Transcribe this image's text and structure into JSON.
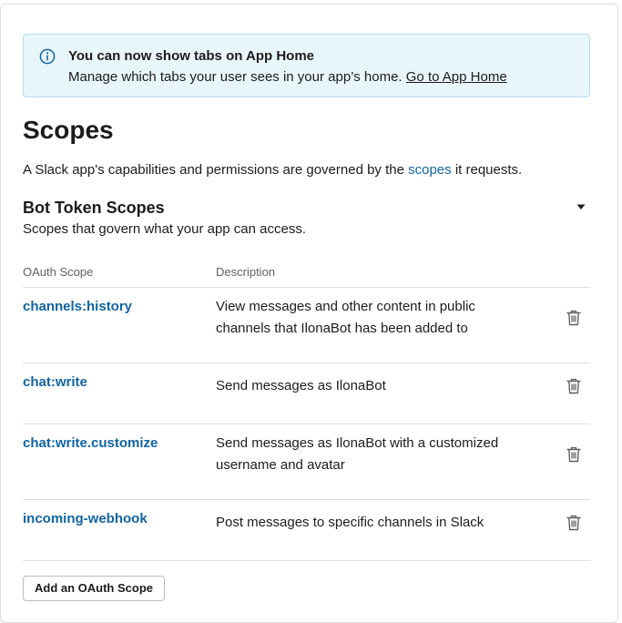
{
  "banner": {
    "icon": "info-icon",
    "title": "You can now show tabs on App Home",
    "text": "Manage which tabs your user sees in your app’s home.",
    "link": "Go to App Home"
  },
  "page": {
    "title": "Scopes",
    "intro_before": "A Slack app's capabilities and permissions are governed by the",
    "intro_link": "scopes",
    "intro_after": "it requests."
  },
  "section": {
    "title": "Bot Token Scopes",
    "subtitle": "Scopes that govern what your app can access.",
    "toggle_icon": "caret-down-icon"
  },
  "table": {
    "headers": {
      "scope": "OAuth Scope",
      "description": "Description"
    },
    "rows": [
      {
        "scope": "channels:history",
        "description": "View messages and other content in public channels that IlonaBot has been added to",
        "action_icon": "trash-icon"
      },
      {
        "scope": "chat:write",
        "description": "Send messages as IlonaBot",
        "action_icon": "trash-icon"
      },
      {
        "scope": "chat:write.customize",
        "description": "Send messages as IlonaBot with a customized username and avatar",
        "action_icon": "trash-icon"
      },
      {
        "scope": "incoming-webhook",
        "description": "Post messages to specific channels in Slack",
        "action_icon": "trash-icon"
      }
    ]
  },
  "actions": {
    "add_scope": "Add an OAuth Scope"
  },
  "colors": {
    "link": "#1264a3",
    "banner_bg": "#e8f5fa",
    "banner_border": "#b6dbee",
    "info_icon": "#1264a3",
    "divider": "#dddddd"
  }
}
